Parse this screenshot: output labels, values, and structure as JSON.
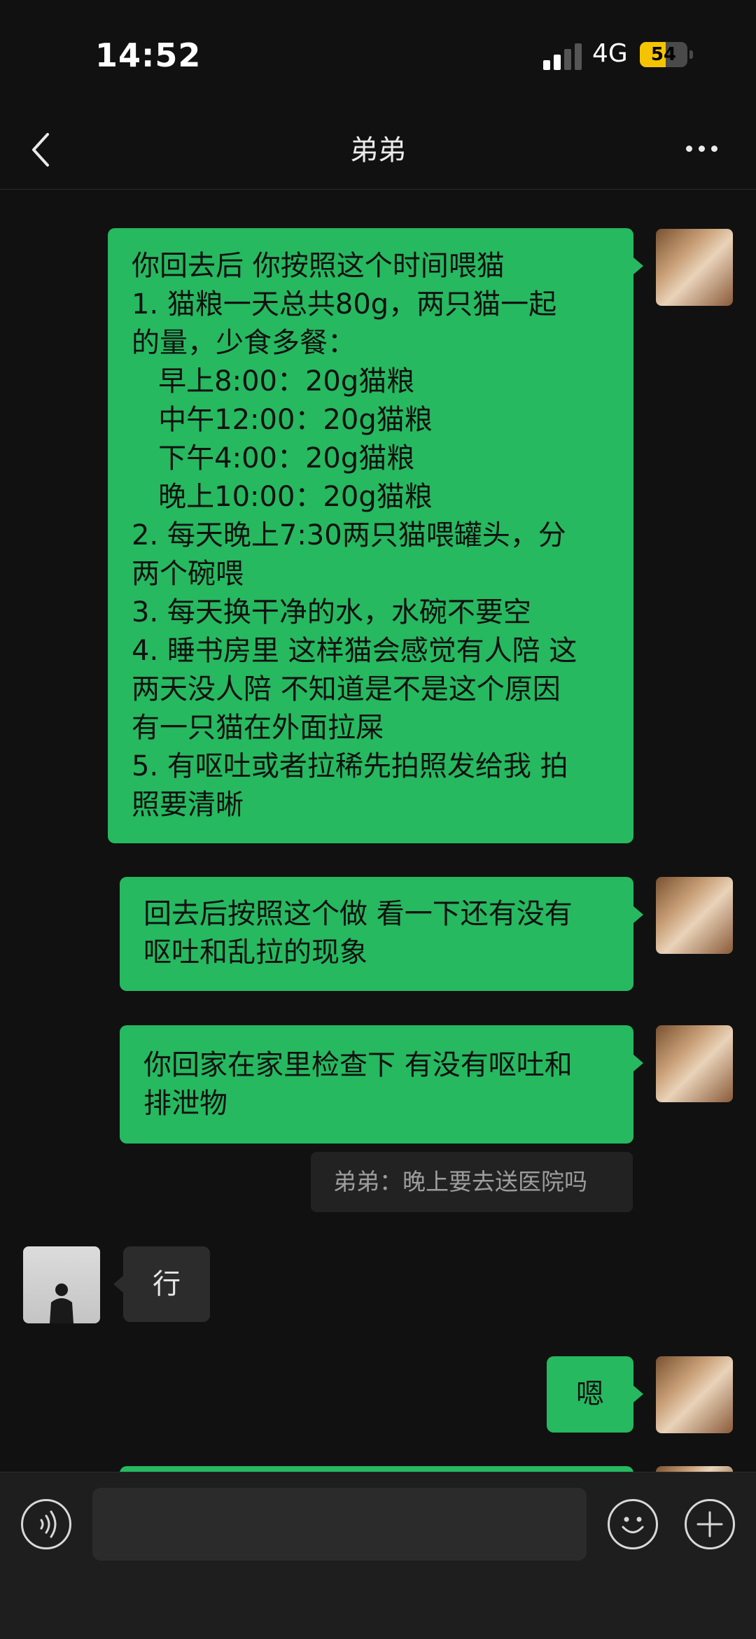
{
  "status": {
    "time": "14:52",
    "network": "4G",
    "battery": "54",
    "battery_level": 0.54
  },
  "header": {
    "title": "弟弟"
  },
  "messages": [
    {
      "sender": "me",
      "lines": [
        "你回去后 你按照这个时间喂猫",
        "1. 猫粮一天总共80g，两只猫一起",
        "的量，少食多餐：",
        "   早上8:00：20g猫粮",
        "   中午12:00：20g猫粮",
        "   下午4:00：20g猫粮",
        "   晚上10:00：20g猫粮",
        "2. 每天晚上7:30两只猫喂罐头，分",
        "两个碗喂",
        "3. 每天换干净的水，水碗不要空",
        "4. 睡书房里 这样猫会感觉有人陪 这",
        "两天没人陪 不知道是不是这个原因",
        "有一只猫在外面拉屎",
        "5. 有呕吐或者拉稀先拍照发给我 拍",
        "照要清晰"
      ]
    },
    {
      "sender": "me",
      "lines": [
        "回去后按照这个做 看一下还有没有",
        "呕吐和乱拉的现象"
      ]
    },
    {
      "sender": "me",
      "lines": [
        "你回家在家里检查下 有没有呕吐和",
        "排泄物"
      ]
    },
    {
      "sender": "other",
      "text": "行"
    },
    {
      "sender": "me",
      "text": "嗯"
    }
  ],
  "quote": {
    "text": "弟弟：晚上要去送医院吗"
  },
  "input": {
    "value": "",
    "placeholder": ""
  },
  "icons": {
    "back": "chevron-left-icon",
    "more": "more-icon",
    "voice": "voice-icon",
    "emoji": "emoji-icon",
    "plus": "plus-icon"
  },
  "colors": {
    "background": "#111111",
    "bubble_me": "#26b960",
    "bubble_other": "#2c2c2c",
    "battery": "#f4c400"
  }
}
